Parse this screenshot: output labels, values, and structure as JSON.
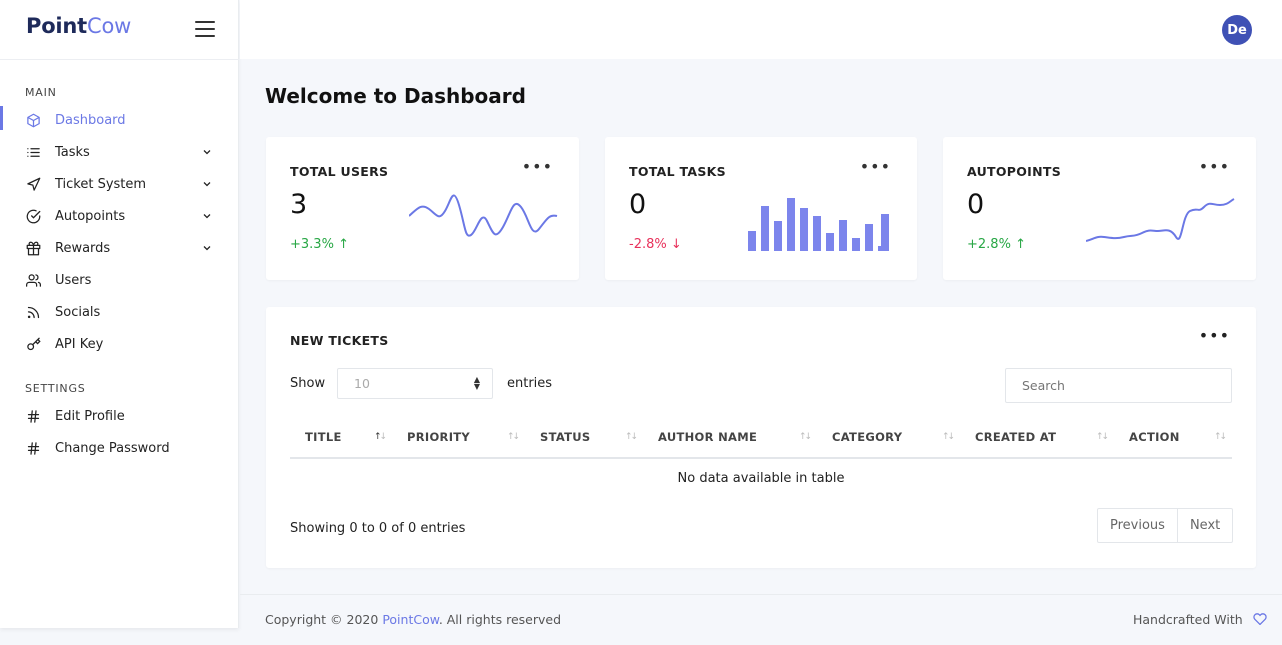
{
  "brand": {
    "part1": "Point",
    "part2": "Cow"
  },
  "sidebar": {
    "sections": [
      {
        "title": "MAIN"
      },
      {
        "title": "SETTINGS"
      }
    ],
    "items": [
      {
        "label": "Dashboard",
        "icon": "cube-icon",
        "active": true
      },
      {
        "label": "Tasks",
        "icon": "list-icon",
        "expandable": true
      },
      {
        "label": "Ticket System",
        "icon": "send-icon",
        "expandable": true
      },
      {
        "label": "Autopoints",
        "icon": "check-circle-icon",
        "expandable": true
      },
      {
        "label": "Rewards",
        "icon": "gift-icon",
        "expandable": true
      },
      {
        "label": "Users",
        "icon": "users-icon"
      },
      {
        "label": "Socials",
        "icon": "rss-icon"
      },
      {
        "label": "API Key",
        "icon": "key-icon"
      },
      {
        "label": "Edit Profile",
        "icon": "hash-icon"
      },
      {
        "label": "Change Password",
        "icon": "hash-icon"
      }
    ]
  },
  "header": {
    "avatar_initials": "De"
  },
  "page": {
    "title": "Welcome to Dashboard"
  },
  "stats": [
    {
      "title": "TOTAL USERS",
      "value": "3",
      "change": "+3.3%",
      "trend": "up",
      "chart": "line"
    },
    {
      "title": "TOTAL TASKS",
      "value": "0",
      "change": "-2.8%",
      "trend": "down",
      "chart": "bar"
    },
    {
      "title": "AUTOPOINTS",
      "value": "0",
      "change": "+2.8%",
      "trend": "up",
      "chart": "line"
    }
  ],
  "tickets": {
    "title": "NEW TICKETS",
    "show_label": "Show",
    "entries_label": "entries",
    "page_size": "10",
    "search_placeholder": "Search",
    "columns": [
      "TITLE",
      "PRIORITY",
      "STATUS",
      "AUTHOR NAME",
      "CATEGORY",
      "CREATED AT",
      "ACTION"
    ],
    "empty_text": "No data available in table",
    "info": "Showing 0 to 0 of 0 entries",
    "prev_label": "Previous",
    "next_label": "Next"
  },
  "footer": {
    "copyright_prefix": "Copyright © 2020 ",
    "company": "PointCow",
    "copyright_suffix": ". All rights reserved",
    "handcrafted": "Handcrafted With"
  },
  "colors": {
    "accent": "#6b78e5",
    "up": "#28a745",
    "down": "#e8315b",
    "avatar": "#3f51b5"
  }
}
